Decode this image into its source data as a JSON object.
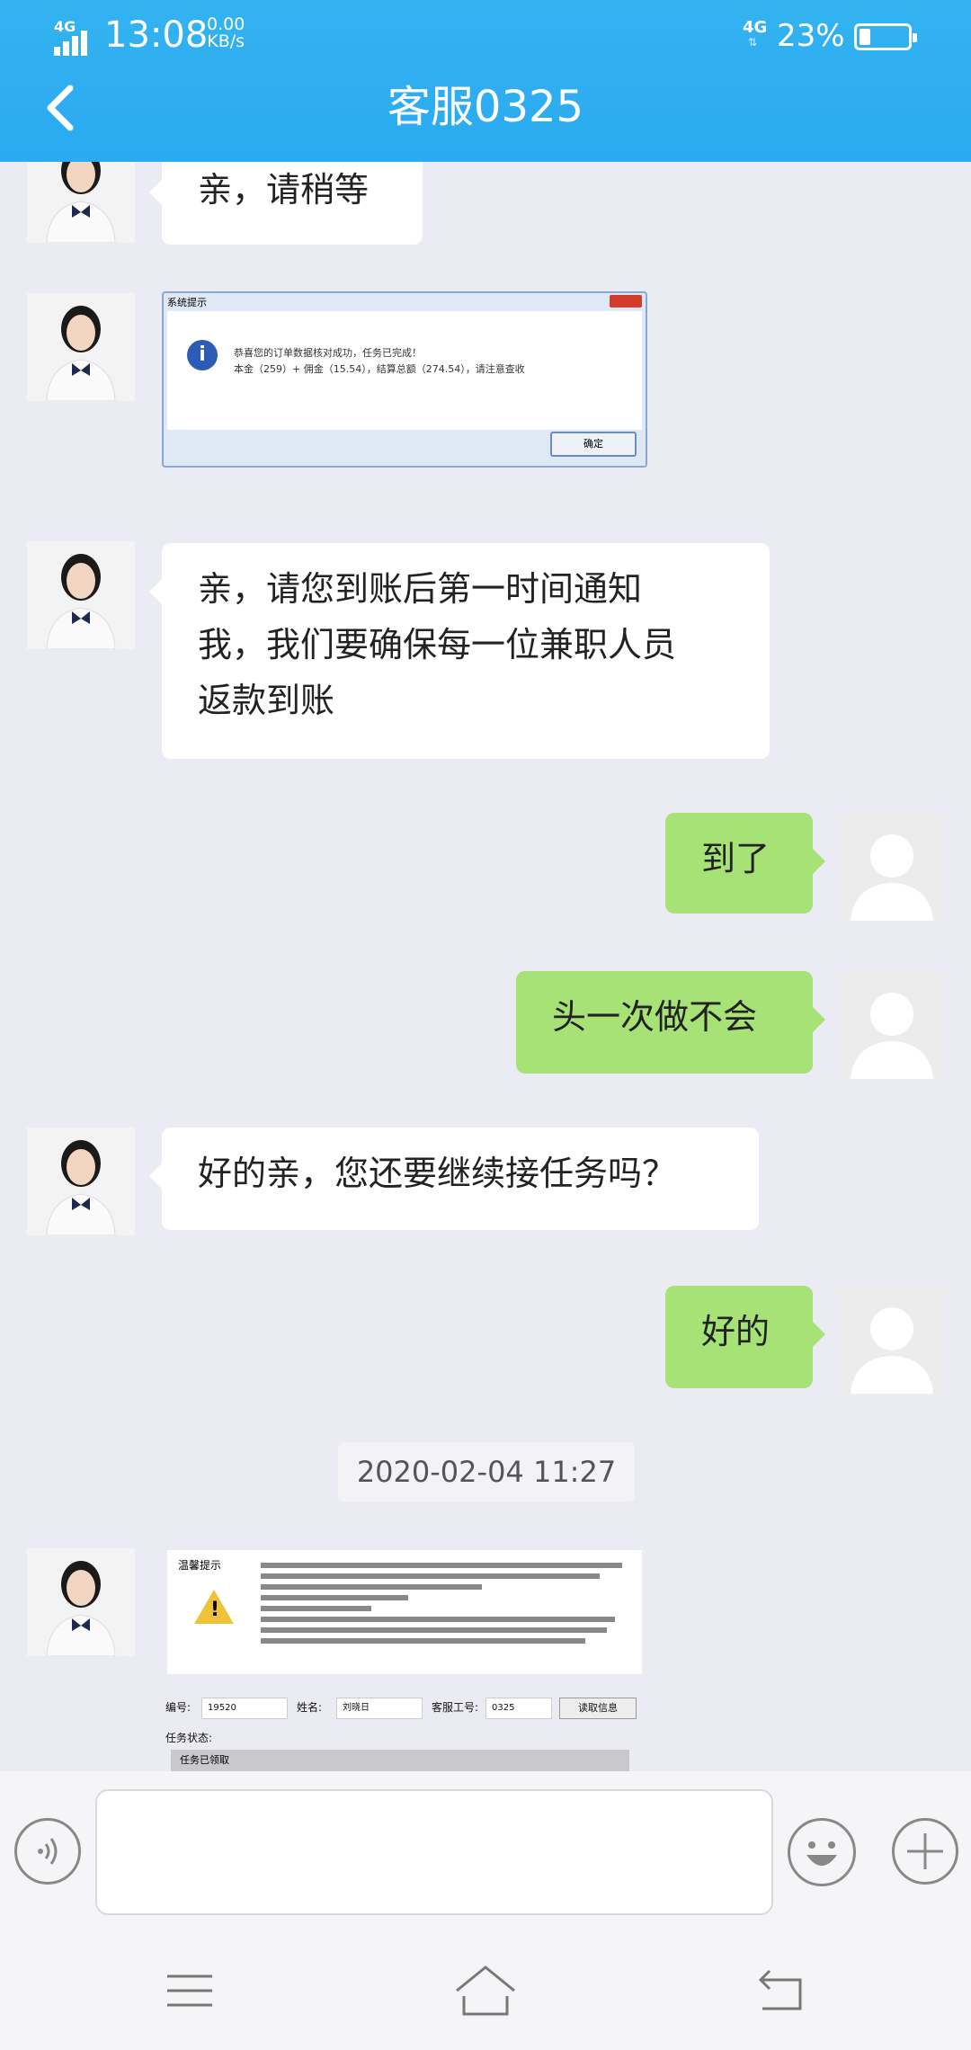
{
  "status_bar": {
    "left_net": "4G",
    "time": "13:08",
    "speed_value": "0.00",
    "speed_unit": "KB/s",
    "right_net": "4G",
    "battery_pct": "23%",
    "battery_level": 0.23
  },
  "header": {
    "title": "客服0325",
    "back_icon": "chevron-left-icon"
  },
  "messages": [
    {
      "side": "left",
      "type": "text",
      "text": "亲，请稍等"
    },
    {
      "side": "left",
      "type": "image",
      "description_label": "系统提示"
    },
    {
      "side": "left",
      "type": "text",
      "lines": [
        "亲，请您到账后第一时间通知",
        "我，我们要确保每一位兼职人员",
        "返款到账"
      ]
    },
    {
      "side": "right",
      "type": "text",
      "text": "到了"
    },
    {
      "side": "right",
      "type": "text",
      "text": "头一次做不会"
    },
    {
      "side": "left",
      "type": "text",
      "text": "好的亲，您还要继续接任务吗？"
    },
    {
      "side": "right",
      "type": "text",
      "text": "好的"
    },
    {
      "side": "left",
      "type": "image",
      "description_label": "温馨提示"
    }
  ],
  "dialog_image": {
    "title": "系统提示",
    "line1": "恭喜您的订单数据核对成功，任务已完成！",
    "line2": "本金（259）+ 佣金（15.54），结算总额（274.54），请注意查收",
    "ok_label": "确定"
  },
  "task_image": {
    "title": "温馨提示",
    "field1_label": "编号:",
    "field1_value": "19520",
    "field2_label": "姓名:",
    "field2_value": "刘晓日",
    "field3_label": "客服工号:",
    "field3_value": "0325",
    "button_label": "读取信息",
    "status_label": "任务状态:",
    "status_value": "任务已领取"
  },
  "timestamp": "2020-02-04 11:27",
  "input_bar": {
    "voice_icon": "voice-icon",
    "emoji_icon": "emoji-icon",
    "plus_icon": "plus-icon",
    "text_value": ""
  },
  "nav_bar": {
    "menu_icon": "menu-icon",
    "home_icon": "home-icon",
    "back_icon": "back-icon"
  },
  "colors": {
    "header_bg": "#2aaaf0",
    "chat_bg": "#ebebf3",
    "bubble_left": "#ffffff",
    "bubble_right": "#a7e276"
  }
}
